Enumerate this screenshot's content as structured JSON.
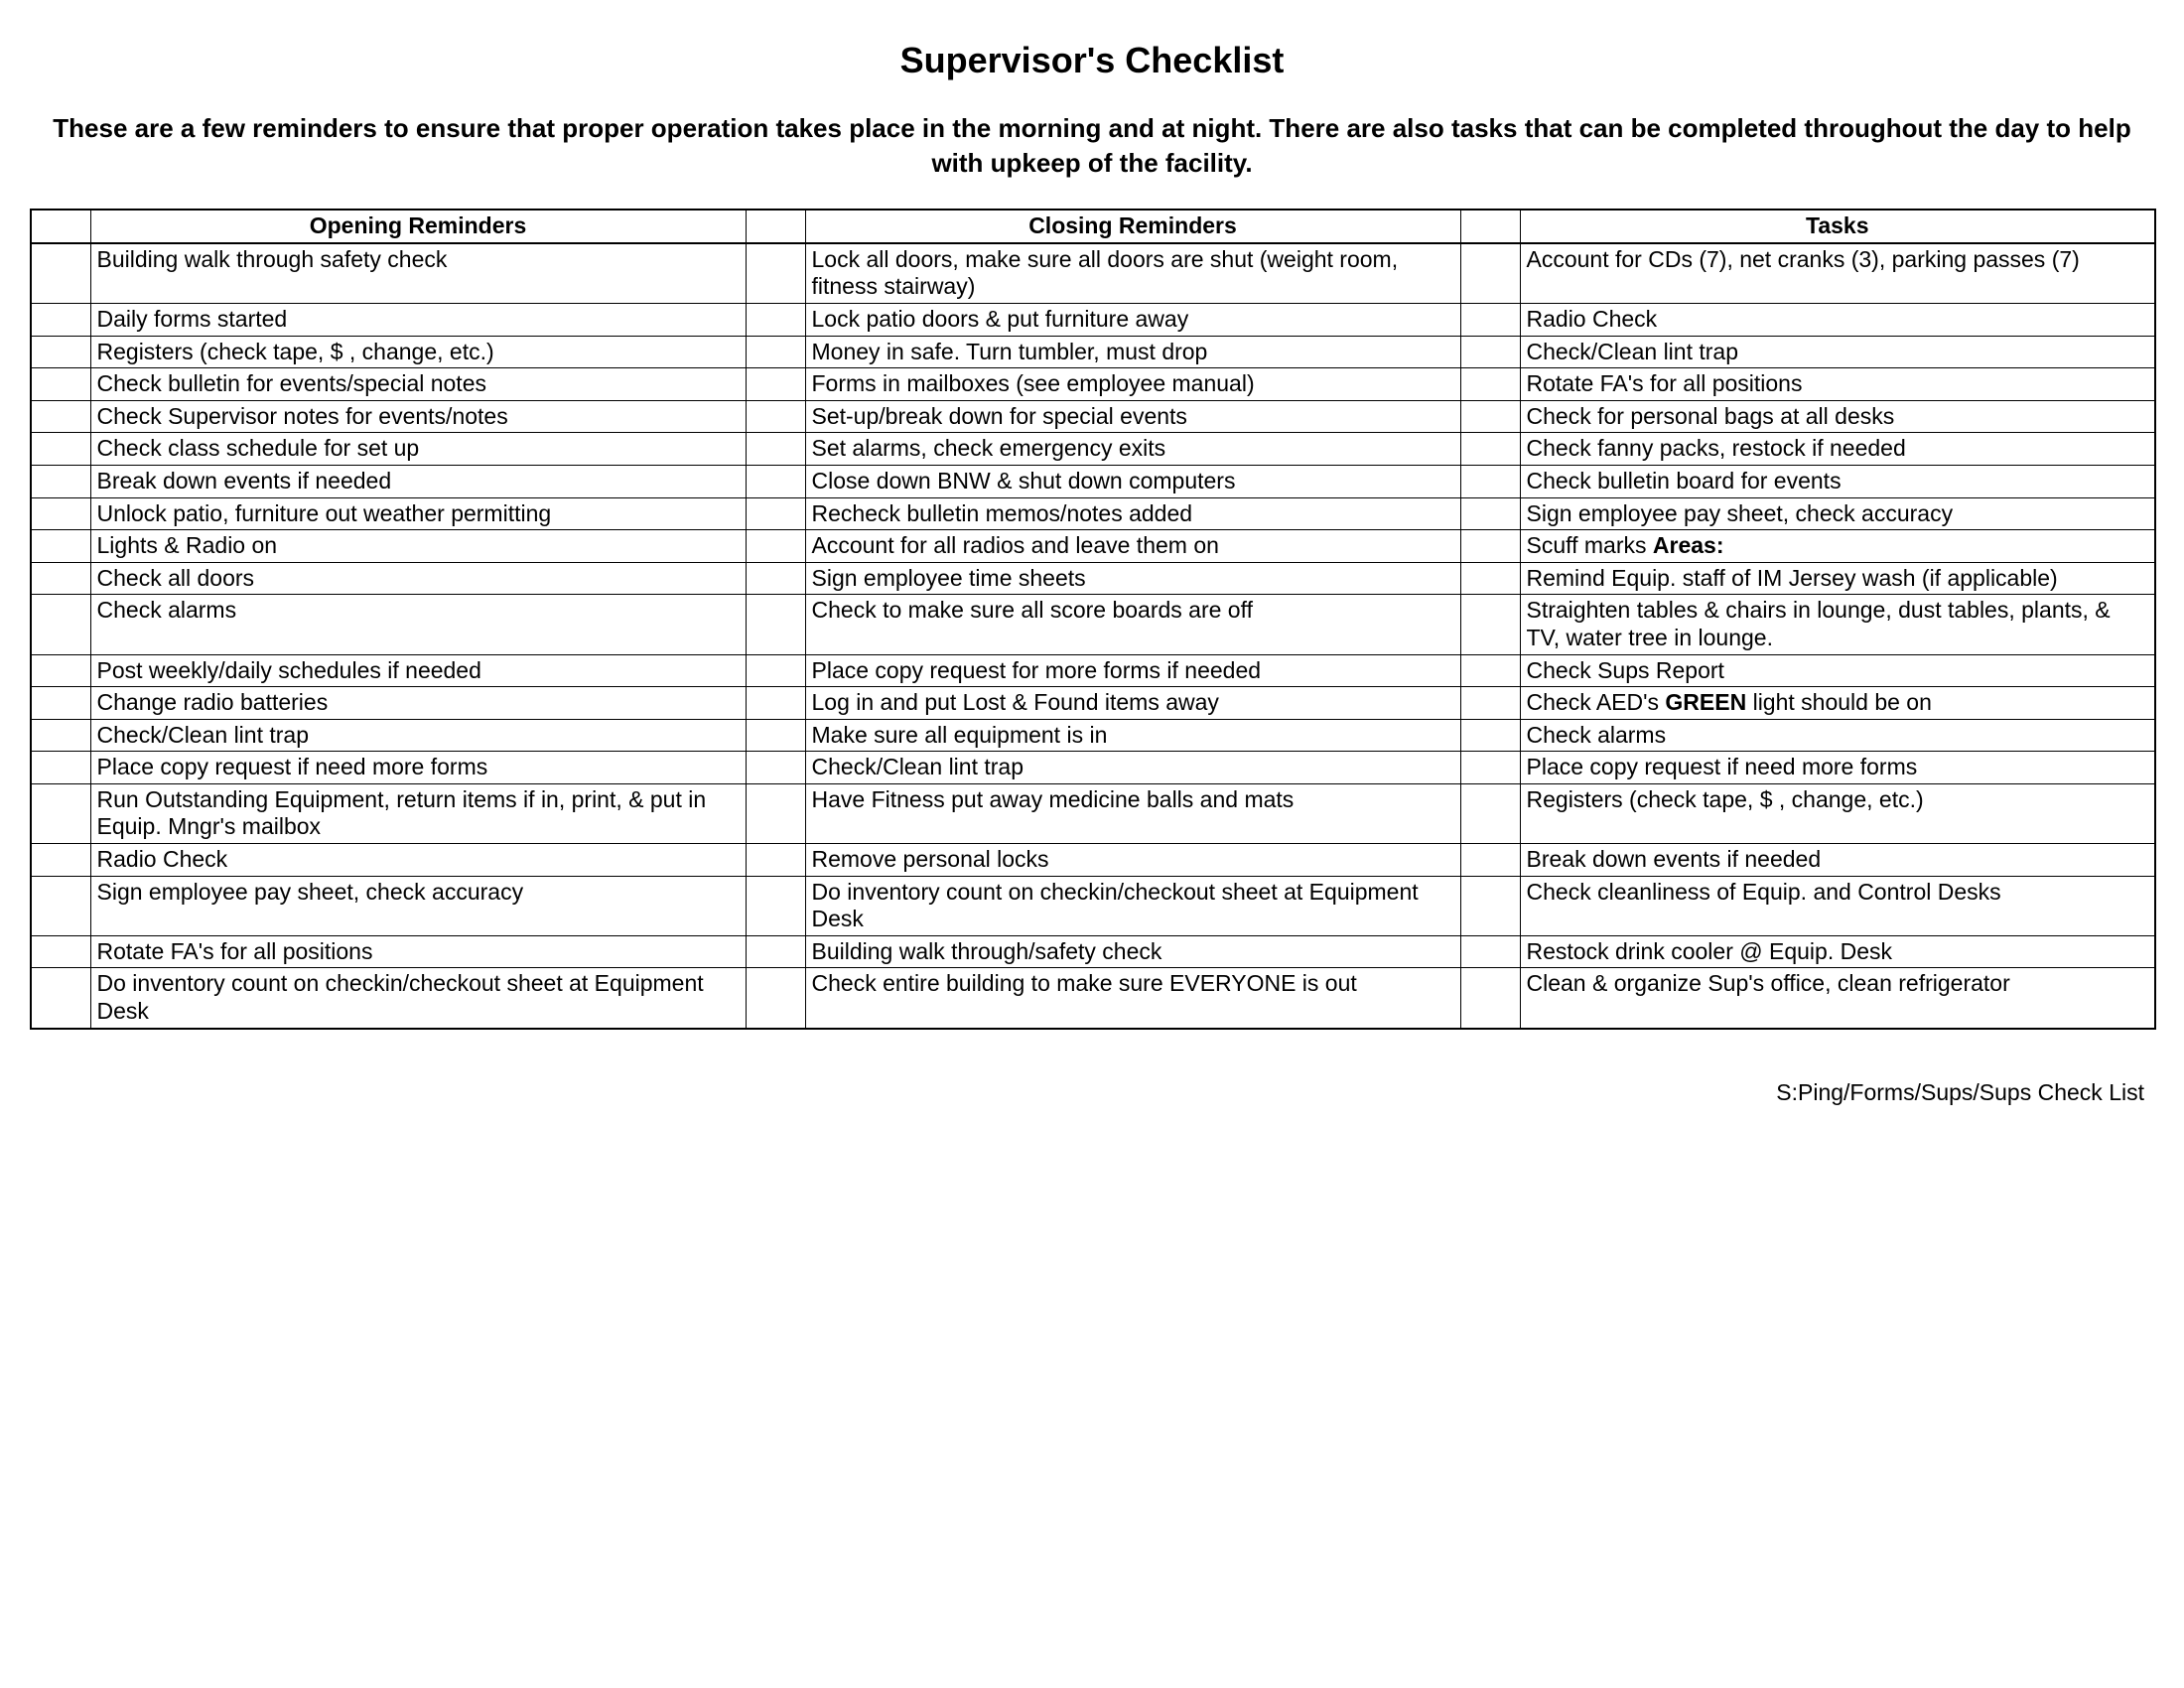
{
  "title": "Supervisor's Checklist",
  "intro": "These are a few reminders to ensure that proper operation takes place in the morning and at night.  There are also tasks that can be completed throughout the day to help with upkeep of the facility.",
  "headers": {
    "opening": "Opening Reminders",
    "closing": "Closing Reminders",
    "tasks": "Tasks"
  },
  "rows": [
    {
      "opening": "Building walk through safety check",
      "closing": "Lock all doors, make sure all doors are shut (weight room, fitness stairway)",
      "tasks": "Account for CDs (7), net cranks (3), parking passes (7)"
    },
    {
      "opening": "Daily forms started",
      "closing": "Lock patio doors & put furniture away",
      "tasks": "Radio Check"
    },
    {
      "opening": "Registers (check tape, $ , change, etc.)",
      "closing": "Money in safe. Turn tumbler, must drop",
      "tasks": "Check/Clean lint trap"
    },
    {
      "opening": "Check bulletin for events/special notes",
      "closing": "Forms in mailboxes (see employee manual)",
      "tasks": "Rotate FA's for all positions"
    },
    {
      "opening": "Check Supervisor notes for events/notes",
      "closing": "Set-up/break down for special events",
      "tasks": "Check for personal bags at all desks"
    },
    {
      "opening": "Check class schedule for set up",
      "closing": "Set alarms, check emergency exits",
      "tasks": "Check fanny packs, restock if needed"
    },
    {
      "opening": "Break down events if needed",
      "closing": "Close down BNW & shut down computers",
      "tasks": "Check bulletin board for events"
    },
    {
      "opening": "Unlock patio, furniture out weather permitting",
      "closing": "Recheck bulletin memos/notes added",
      "tasks": "Sign employee pay sheet, check accuracy"
    },
    {
      "opening": "Lights & Radio on",
      "closing": "Account for all radios and leave them on",
      "tasks_html": "Scuff marks <strong class='inline'>Areas:</strong>"
    },
    {
      "opening": "Check all doors",
      "closing": "Sign employee time sheets",
      "tasks": "Remind Equip. staff of IM Jersey wash (if applicable)"
    },
    {
      "opening": "Check alarms",
      "closing": "Check to make sure all score boards are off",
      "tasks": "Straighten tables & chairs in lounge, dust tables, plants, & TV, water tree in lounge."
    },
    {
      "opening": "Post weekly/daily schedules if needed",
      "closing": "Place copy request for more forms if needed",
      "tasks": "Check Sups Report"
    },
    {
      "opening": "Change radio batteries",
      "closing": "Log in and put Lost & Found items away",
      "tasks_html": "Check AED's <strong class='inline'>GREEN</strong> light should be on"
    },
    {
      "opening": "Check/Clean lint trap",
      "closing": "Make sure all equipment is in",
      "tasks": "Check alarms"
    },
    {
      "opening": "Place copy request if need more forms",
      "closing": "Check/Clean lint trap",
      "tasks": "Place copy request if need more forms"
    },
    {
      "opening": "Run Outstanding Equipment, return items if in, print, & put in Equip. Mngr's mailbox",
      "closing": "Have Fitness put away medicine balls and mats",
      "tasks": "Registers (check tape, $ , change, etc.)"
    },
    {
      "opening": "Radio Check",
      "closing": "Remove personal locks",
      "tasks": "Break down events if needed"
    },
    {
      "opening": "Sign employee pay sheet, check accuracy",
      "closing": "Do inventory count on checkin/checkout sheet at Equipment Desk",
      "tasks": "Check cleanliness of Equip. and Control Desks"
    },
    {
      "opening": "Rotate FA's for all positions",
      "closing": "Building walk through/safety check",
      "tasks": "Restock drink cooler @ Equip. Desk"
    },
    {
      "opening": "Do inventory count on checkin/checkout sheet at Equipment Desk",
      "closing": "Check entire building to make sure EVERYONE is out",
      "tasks": "Clean & organize Sup's office, clean refrigerator"
    }
  ],
  "footer": "S:Ping/Forms/Sups/Sups Check List"
}
